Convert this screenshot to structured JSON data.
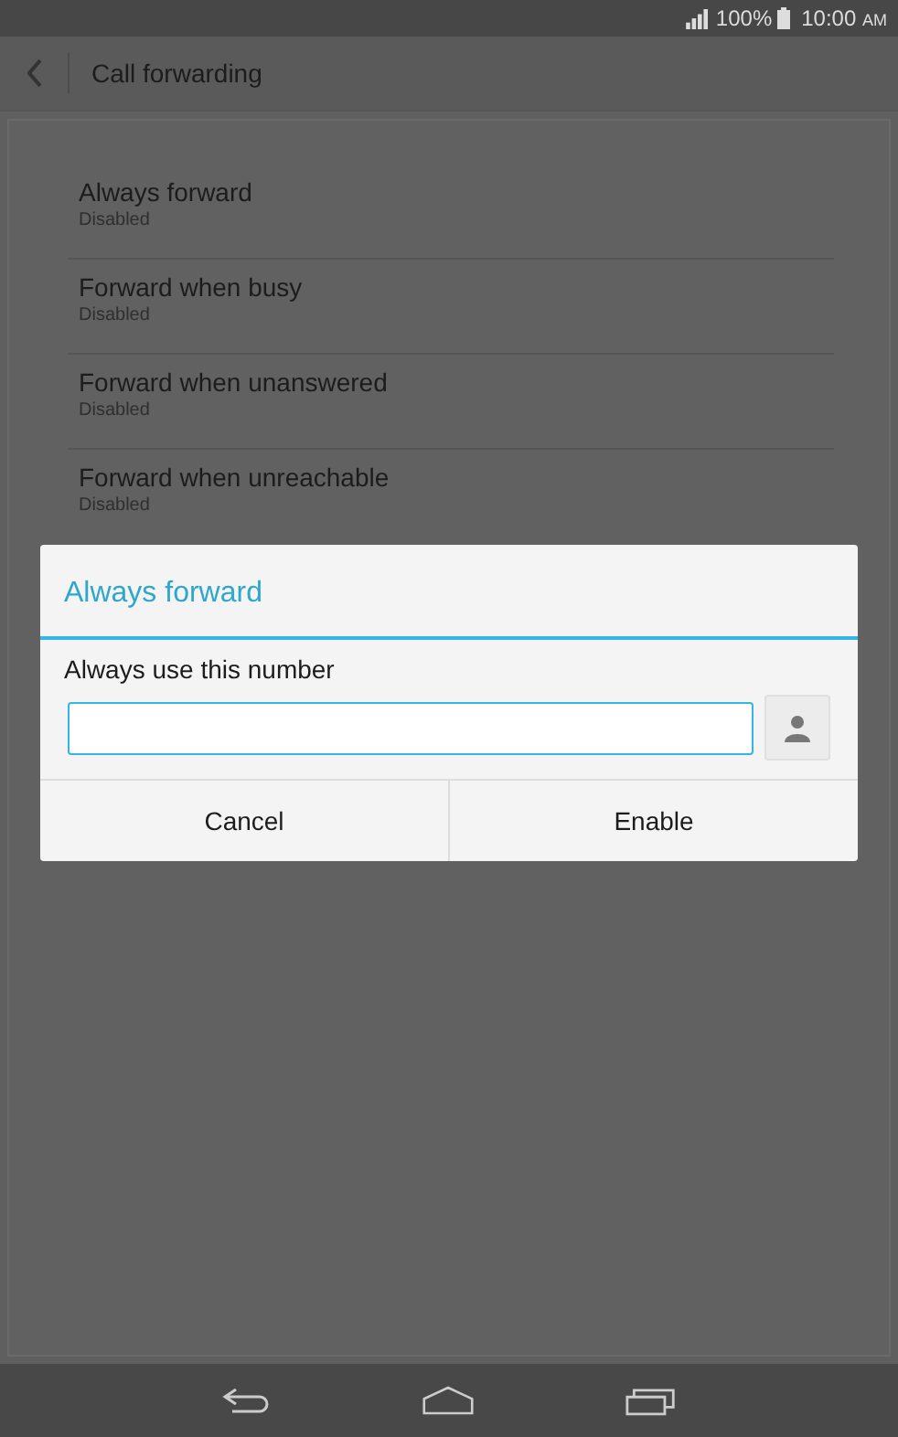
{
  "status_bar": {
    "battery": "100%",
    "time": "10:00",
    "time_suffix": "AM"
  },
  "app_bar": {
    "title": "Call forwarding"
  },
  "settings": [
    {
      "title": "Always forward",
      "summary": "Disabled"
    },
    {
      "title": "Forward when busy",
      "summary": "Disabled"
    },
    {
      "title": "Forward when unanswered",
      "summary": "Disabled"
    },
    {
      "title": "Forward when unreachable",
      "summary": "Disabled"
    }
  ],
  "dialog": {
    "title": "Always forward",
    "label": "Always use this number",
    "buttons": [
      "Cancel",
      "Enable"
    ]
  }
}
